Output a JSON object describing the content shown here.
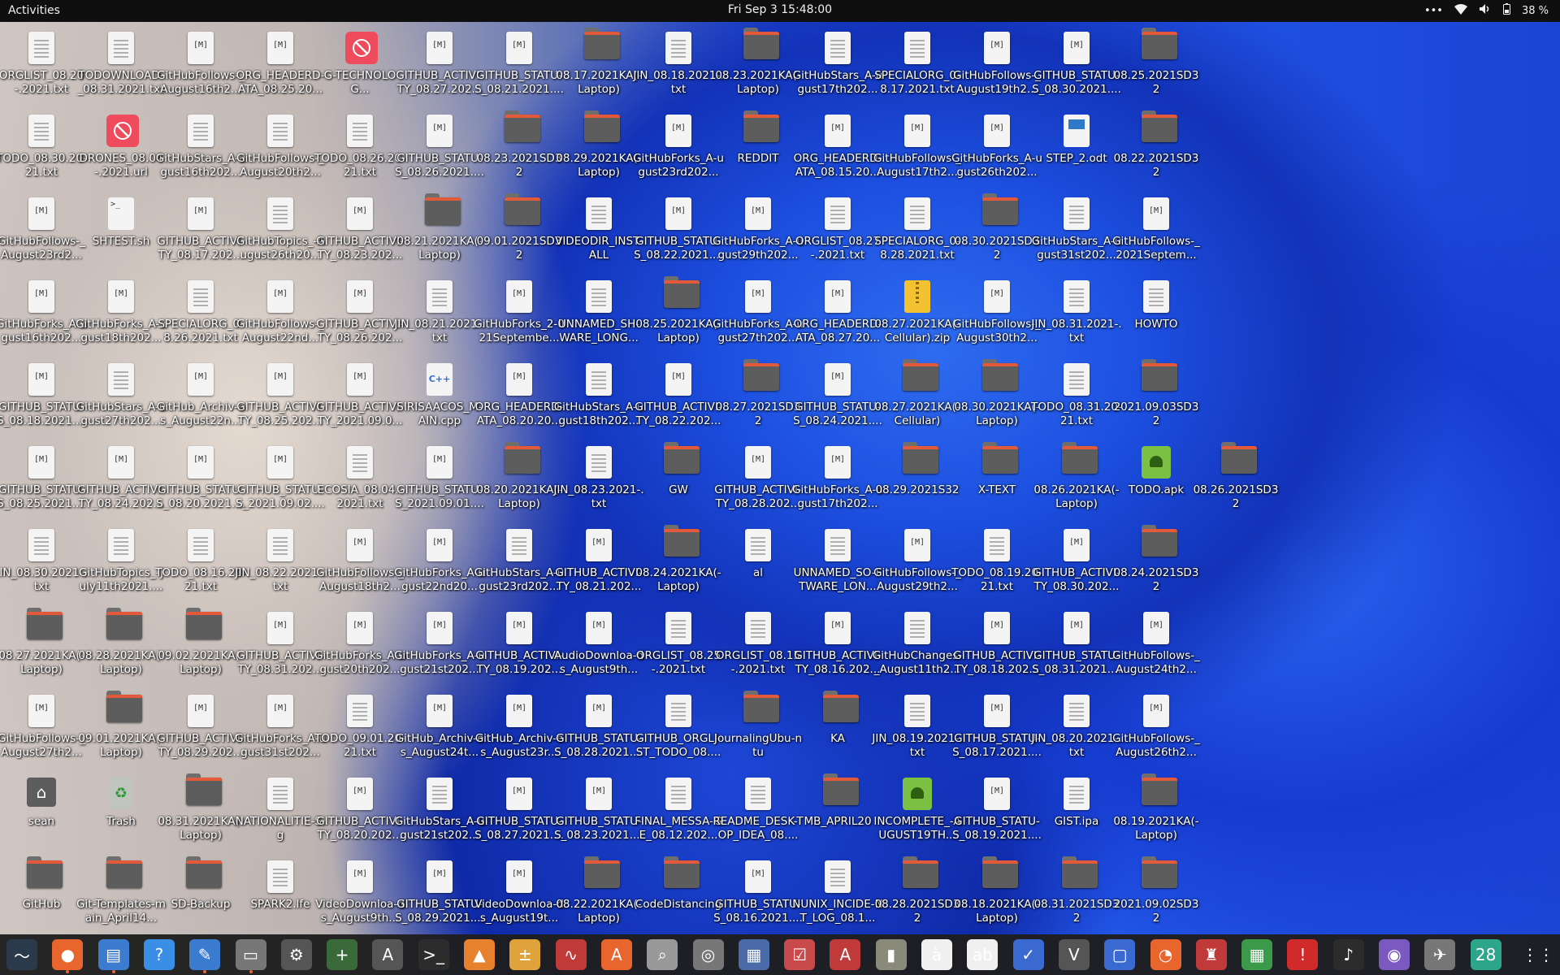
{
  "topbar": {
    "activities": "Activities",
    "clock": "Fri Sep 3  15:48:00",
    "battery": "38 %"
  },
  "icon_grid": [
    [
      "doc:ORGLIST_08.20-.2021.txt",
      "doc:TODOWNLOAD-_08.31.2021.txt",
      "html:GitHubFollows-_August16th2...",
      "html:ORG_HEADERD-ATA_08.25.20...",
      "blocked:G-TECHNOLOG...",
      "html:GITHUB_ACTIVI-TY_08.27.202...",
      "html:GITHUB_STATU-S_08.21.2021....",
      "folder:08.17.2021KA(-Laptop)",
      "doc:JIN_08.18.2021-.txt",
      "folder:08.23.2021KA(-Laptop)",
      "doc:GitHubStars_A-ugust17th202...",
      "doc:SPECIALORG_0-8.17.2021.txt",
      "html:GitHubFollows-_August19th2...",
      "html:GITHUB_STATU-S_08.30.2021....",
      "folder:08.25.2021SD32"
    ],
    [
      "doc:TODO_08.30.20-21.txt",
      "blocked:DRONES_08.04-.2021.url",
      "doc:GitHubStars_A-ugust16th202...",
      "doc:GitHubFollows-_August20th2...",
      "doc:TODO_08.26.20-21.txt",
      "html:GITHUB_STATU-S_08.26.2021....",
      "folder:08.23.2021SD32",
      "folder:08.29.2021KA(-Laptop)",
      "html:GitHubForks_A-ugust23rd202...",
      "folder:REDDIT",
      "html:ORG_HEADERD-ATA_08.15.20...",
      "html:GitHubFollows-_August17th2...",
      "html:GitHubForks_A-ugust26th202...",
      "odt:STEP_2.odt",
      "folder:08.22.2021SD32"
    ],
    [
      "html:GitHubFollows-_August23rd2...",
      "script:SHTEST.sh",
      "html:GITHUB_ACTIVI-TY_08.17.202...",
      "doc:GitHubTopics_-August26th20...",
      "html:GITHUB_ACTIVI-TY_08.23.202...",
      "folder:08.21.2021KA(-Laptop)",
      "folder:09.01.2021SD32",
      "doc:VIDEODIR_INST-ALL",
      "html:GITHUB_STATU-S_08.22.2021....",
      "html:GitHubForks_A-ugust29th202...",
      "doc:ORGLIST_08.27-.2021.txt",
      "doc:SPECIALORG_0-8.28.2021.txt",
      "folder:08.30.2021SD32",
      "doc:GitHubStars_A-ugust31st202...",
      "html:GitHubFollows-_2021Septem..."
    ],
    [
      "html:GitHubForks_A-ugust16th202...",
      "html:GitHubForks_A-ugust18th202...",
      "doc:SPECIALORG_0-8.26.2021.txt",
      "html:GitHubFollows-_August22nd...",
      "html:GITHUB_ACTIVI-TY_08.26.202...",
      "doc:JIN_08.21.2021-.txt",
      "html:GitHubForks_2-021Septembe...",
      "doc:UNNAMED_SH-WARE_LONG...",
      "folder:08.25.2021KA(-Laptop)",
      "html:GitHubForks_A-ugust27th202...",
      "html:ORG_HEADERD-ATA_08.27.20...",
      "zip:08.27.2021KA(-Cellular).zip",
      "html:GitHubFollows-_August30th2...",
      "doc:JIN_08.31.2021-.txt",
      "doc:HOWTO"
    ],
    [
      "html:GITHUB_STATU-S_08.18.2021....",
      "doc:GitHubStars_A-ugust27th202...",
      "html:GitHub_Archiv-es_August22n...",
      "html:GITHUB_ACTIVI-TY_08.25.202...",
      "html:GITHUB_ACTIVI-TY_2021.09.0...",
      "cpp:SIRISAACOS_M-AIN.cpp",
      "html:ORG_HEADERD-ATA_08.20.20...",
      "doc:GitHubStars_A-ugust18th202...",
      "html:GITHUB_ACTIVI-TY_08.22.202...",
      "folder:08.27.2021SD32",
      "html:GITHUB_STATU-S_08.24.2021....",
      "folder:08.27.2021KA(-Cellular)",
      "folder:08.30.2021KA(-Laptop)",
      "doc:TODO_08.31.20-21.txt",
      "folder:2021.09.03SD32"
    ],
    [
      "html:GITHUB_STATU-S_08.25.2021....",
      "html:GITHUB_ACTIVI-TY_08.24.202...",
      "html:GITHUB_STATU-S_08.20.2021....",
      "html:GITHUB_STATU-S_2021.09.02....",
      "doc:ECOSIA_08.04.-2021.txt",
      "html:GITHUB_STATU-S_2021.09.01....",
      "folder:08.20.2021KA(-Laptop)",
      "doc:JIN_08.23.2021-.txt",
      "folder:GW",
      "html:GITHUB_ACTIVI-TY_08.28.202...",
      "html:GitHubForks_A-ugust17th202...",
      "folder:08.29.2021S32",
      "folder:X-TEXT",
      "folder:08.26.2021KA(-Laptop)",
      "apk:TODO.apk",
      "folder:08.26.2021SD32"
    ],
    [
      "doc:JIN_08.30.2021-.txt",
      "doc:GitHubTopics_-July11th2021....",
      "doc:TODO_08.16.20-21.txt",
      "doc:JIN_08.22.2021-.txt",
      "html:GitHubFollows-_August18th2...",
      "html:GitHubForks_A-ugust22nd20...",
      "doc:GitHubStars_A-ugust23rd202...",
      "html:GITHUB_ACTIVI-TY_08.21.202...",
      "folder:08.24.2021KA(-Laptop)",
      "doc:al",
      "doc:UNNAMED_SO-FTWARE_LON...",
      "html:GitHubFollows-_August29th2...",
      "doc:TODO_08.19.20-21.txt",
      "html:GITHUB_ACTIVI-TY_08.30.202...",
      "folder:08.24.2021SD32"
    ],
    [
      "folder:08.27.2021KA(-Laptop)",
      "folder:08.28.2021KA(-Laptop)",
      "folder:09.02.2021KA(-Laptop)",
      "html:GITHUB_ACTIVI-TY_08.31.202...",
      "html:GitHubForks_A-ugust20th202...",
      "html:GitHubForks_A-ugust21st202...",
      "html:GITHUB_ACTIVI-TY_08.19.202...",
      "html:AudioDownloa-ds_August9th...",
      "doc:ORGLIST_08.25-.2021.txt",
      "doc:ORGLIST_08.15-.2021.txt",
      "html:GITHUB_ACTIVI-TY_08.16.202...",
      "doc:GitHubChanges-_August11th2...",
      "html:GITHUB_ACTIVI-TY_08.18.202...",
      "html:GITHUB_STATU-S_08.31.2021....",
      "html:GitHubFollows-_August24th2..."
    ],
    [
      "html:GitHubFollows-_August27th2...",
      "folder:09.01.2021KA(-Laptop)",
      "html:GITHUB_ACTIVI-TY_08.29.202...",
      "html:GitHubForks_A-ugust31st202...",
      "doc:TODO_09.01.20-21.txt",
      "html:GitHub_Archiv-es_August24t...",
      "html:GitHub_Archiv-es_August23r...",
      "html:GITHUB_STATU-S_08.28.2021....",
      "doc:GITHUB_ORGLI-ST_TODO_08....",
      "folder:JournalingUbu-ntu",
      "folder:KA",
      "doc:JIN_08.19.2021-.txt",
      "html:GITHUB_STATU-S_08.17.2021....",
      "doc:JIN_08.20.2021-.txt",
      "html:GitHubFollows-_August26th2..."
    ],
    [
      "home:sean",
      "trash:Trash",
      "folder:08.31.2021KA(-Laptop)",
      "doc:NATIONALITIE-S.g",
      "html:GITHUB_ACTIVI-TY_08.20.202...",
      "doc:GitHubStars_A-ugust21st202...",
      "html:GITHUB_STATU-S_08.27.2021....",
      "html:GITHUB_STATU-S_08.23.2021....",
      "doc:FINAL_MESSA-GE_08.12.202...",
      "doc:README_DESK-TOP_IDEA_08....",
      "folder:MB_APRIL20",
      "apk:INCOMPLETE_-AUGUST19TH...",
      "html:GITHUB_STATU-S_08.19.2021....",
      "doc:GIST.ipa",
      "folder:08.19.2021KA(-Laptop)"
    ],
    [
      "folder:GitHub",
      "folder:Git-Templates-main_April14...",
      "folder:SD-Backup",
      "doc:SPARK2.lfe",
      "html:VideoDownloa-ds_August9th...",
      "html:GITHUB_STATU-S_08.29.2021....",
      "html:VideoDownloa-ds_August19t...",
      "folder:08.22.2021KA(-Laptop)",
      "folder:CodeDistancing",
      "html:GITHUB_STATU-S_08.16.2021....",
      "doc:NUNIX_INCIDE-NT_LOG_08.1...",
      "folder:08.28.2021SD32",
      "folder:08.18.2021KA(-Laptop)",
      "folder:08.31.2021SD32",
      "folder:2021.09.02SD32"
    ]
  ],
  "dock": [
    {
      "icon": "system-monitor-icon",
      "glyph": "〜",
      "bg": "#2b3a4a"
    },
    {
      "icon": "firefox-icon",
      "glyph": "●",
      "bg": "#e8662e",
      "running": true
    },
    {
      "icon": "text-editor-icon",
      "glyph": "▤",
      "bg": "#3b7bd0",
      "running": true
    },
    {
      "icon": "help-icon",
      "glyph": "?",
      "bg": "#3a8ee6"
    },
    {
      "icon": "writer-icon",
      "glyph": "✎",
      "bg": "#3b7bd0",
      "running": true
    },
    {
      "icon": "files-icon",
      "glyph": "▭",
      "bg": "#777777",
      "running": true
    },
    {
      "icon": "settings-icon",
      "glyph": "⚙",
      "bg": "#555555"
    },
    {
      "icon": "terminal-plus-icon",
      "glyph": "+",
      "bg": "#3a6a3a"
    },
    {
      "icon": "software-updater-icon",
      "glyph": "A",
      "bg": "#555555"
    },
    {
      "icon": "terminal-icon",
      "glyph": ">_",
      "bg": "#2c2c2c"
    },
    {
      "icon": "vlc-icon",
      "glyph": "▲",
      "bg": "#e8812e"
    },
    {
      "icon": "calculator-icon",
      "glyph": "±",
      "bg": "#e0a23a"
    },
    {
      "icon": "chart-icon",
      "glyph": "∿",
      "bg": "#c03a3a"
    },
    {
      "icon": "app-center-icon",
      "glyph": "A",
      "bg": "#e8662e"
    },
    {
      "icon": "search-tool-icon",
      "glyph": "⌕",
      "bg": "#999999"
    },
    {
      "icon": "disc-icon",
      "glyph": "◎",
      "bg": "#777777"
    },
    {
      "icon": "image-viewer-icon",
      "glyph": "▦",
      "bg": "#4a6aa8"
    },
    {
      "icon": "checklist-icon",
      "glyph": "☑",
      "bg": "#c84a4a"
    },
    {
      "icon": "pdf-icon",
      "glyph": "A",
      "bg": "#c03a3a"
    },
    {
      "icon": "archive-icon",
      "glyph": "▮",
      "bg": "#8a8a7a"
    },
    {
      "icon": "fonts-icon",
      "glyph": "à",
      "bg": "#f0f0f0"
    },
    {
      "icon": "dictionary-icon",
      "glyph": "ab",
      "bg": "#f0f0f0"
    },
    {
      "icon": "tasks-icon",
      "glyph": "✓",
      "bg": "#3a6ad0"
    },
    {
      "icon": "vim-icon",
      "glyph": "V",
      "bg": "#555555"
    },
    {
      "icon": "screen-icon",
      "glyph": "▢",
      "bg": "#3a6ad0"
    },
    {
      "icon": "ubuntu-one-icon",
      "glyph": "◔",
      "bg": "#e8662e"
    },
    {
      "icon": "mario-icon",
      "glyph": "♜",
      "bg": "#c03a3a"
    },
    {
      "icon": "spreadsheet-icon",
      "glyph": "▦",
      "bg": "#3a9a4a"
    },
    {
      "icon": "alert-icon",
      "glyph": "!",
      "bg": "#d02a2a"
    },
    {
      "icon": "music-icon",
      "glyph": "♪",
      "bg": "#2c2c2c"
    },
    {
      "icon": "camera-icon",
      "glyph": "◉",
      "bg": "#7a5ac0"
    },
    {
      "icon": "satellite-icon",
      "glyph": "✈",
      "bg": "#777777"
    },
    {
      "icon": "calendar-icon",
      "glyph": "28",
      "bg": "#2ca58a"
    },
    {
      "icon": "app-grid-icon",
      "glyph": "⋮⋮",
      "bg": "transparent"
    }
  ]
}
